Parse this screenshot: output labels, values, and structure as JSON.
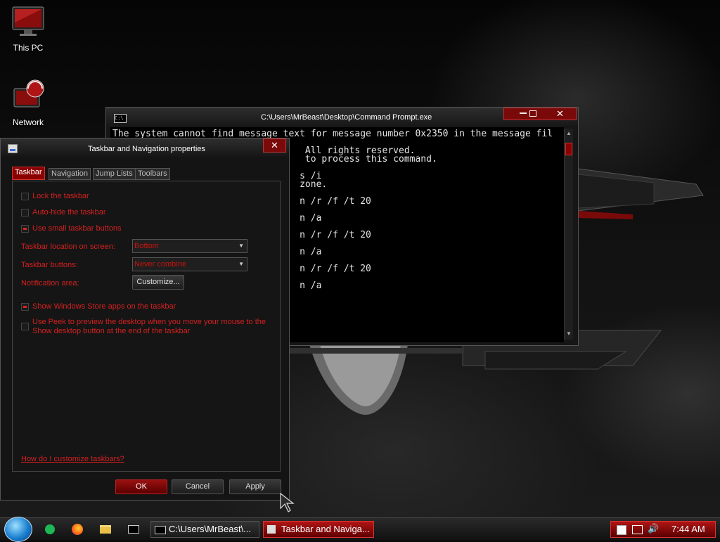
{
  "desktop": {
    "icons": [
      {
        "label": "This PC",
        "icon": "computer-icon"
      },
      {
        "label": "Network",
        "icon": "network-icon"
      }
    ]
  },
  "cmd_window": {
    "title": "C:\\Users\\MrBeast\\Desktop\\Command Prompt.exe",
    "lines": [
      "The system cannot find message text for message number 0x2350 in the message fil",
      "",
      "                                   All rights reserved.",
      "                                   to process this command.",
      "",
      "                                  s /i",
      "                                  zone.",
      "",
      "                                  n /r /f /t 20",
      "",
      "                                  n /a",
      "",
      "                                  n /r /f /t 20",
      "",
      "                                  n /a",
      "",
      "                                  n /r /f /t 20",
      "",
      "                                  n /a"
    ]
  },
  "props_window": {
    "title": "Taskbar and Navigation properties",
    "tabs": [
      "Taskbar",
      "Navigation",
      "Jump Lists",
      "Toolbars"
    ],
    "active_tab": "Taskbar",
    "checkboxes": [
      {
        "label": "Lock the taskbar",
        "checked": false
      },
      {
        "label": "Auto-hide the taskbar",
        "checked": false
      },
      {
        "label": "Use small taskbar buttons",
        "checked": true
      }
    ],
    "location_label": "Taskbar location on screen:",
    "location_value": "Bottom",
    "buttons_label": "Taskbar buttons:",
    "buttons_value": "Never combine",
    "notification_label": "Notification area:",
    "customize_label": "Customize...",
    "store_apps": {
      "label": "Show Windows Store apps on the taskbar",
      "checked": true
    },
    "peek": {
      "line1": "Use Peek to preview the desktop when you move your mouse to the",
      "line2": "Show desktop button at the end of the taskbar",
      "checked": false
    },
    "help_link": "How do I customize taskbars?",
    "ok_label": "OK",
    "cancel_label": "Cancel",
    "apply_label": "Apply"
  },
  "taskbar": {
    "items": [
      {
        "label": "C:\\Users\\MrBeast\\...",
        "active": false
      },
      {
        "label": "Taskbar and Naviga...",
        "active": true
      }
    ],
    "clock": "7:44 AM"
  },
  "colors": {
    "accent_red": "#8b0000",
    "text_red": "#d42020",
    "window_bg": "#141414",
    "cmd_bg": "#000000"
  }
}
